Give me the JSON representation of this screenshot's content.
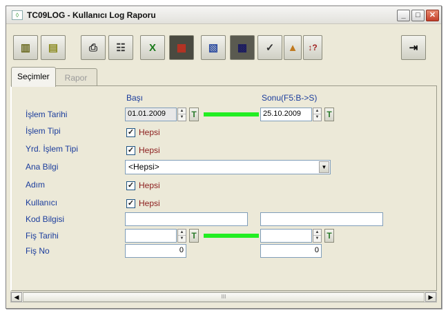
{
  "window": {
    "title": "TC09LOG - Kullanıcı Log Raporu",
    "minimize": "_",
    "maximize": "□",
    "close": "✕"
  },
  "toolbar": {
    "buttons": [
      {
        "name": "book-icon",
        "glyph": "▥"
      },
      {
        "name": "notes-icon",
        "glyph": "▤"
      },
      {
        "name": "print-icon",
        "glyph": "⎙"
      },
      {
        "name": "options-icon",
        "glyph": "☷"
      },
      {
        "name": "excel-icon",
        "glyph": "X"
      },
      {
        "name": "report-icon",
        "glyph": "▦"
      },
      {
        "name": "document-icon",
        "glyph": "▧"
      },
      {
        "name": "grid-icon",
        "glyph": "▩"
      },
      {
        "name": "checklist-icon",
        "glyph": "✓"
      },
      {
        "name": "color-icon",
        "glyph": "▲"
      },
      {
        "name": "sort-help-icon",
        "glyph": "↕?"
      },
      {
        "name": "exit-icon",
        "glyph": "⇥"
      }
    ]
  },
  "tabs": {
    "selections": "Seçimler",
    "report": "Rapor"
  },
  "form": {
    "header_start": "Başı",
    "header_end": "Sonu(F5:B->S)",
    "islem_tarihi_label": "İşlem Tarihi",
    "islem_tarihi_start": "01.01.2009",
    "islem_tarihi_end": "25.10.2009",
    "islem_tipi_label": "İşlem Tipi",
    "yrd_islem_tipi_label": "Yrd. İşlem Tipi",
    "ana_bilgi_label": "Ana Bilgi",
    "ana_bilgi_value": "<Hepsi>",
    "adim_label": "Adım",
    "kullanici_label": "Kullanıcı",
    "kod_bilgisi_label": "Kod Bilgisi",
    "kod_bilgisi_start": "",
    "kod_bilgisi_end": "",
    "fis_tarihi_label": "Fiş Tarihi",
    "fis_tarihi_start": "",
    "fis_tarihi_end": "",
    "fis_no_label": "Fiş No",
    "fis_no_start": "0",
    "fis_no_end": "0",
    "hepsi": "Hepsi",
    "t_button": "T"
  },
  "scrollbar": {
    "thumb_grip": "III"
  }
}
